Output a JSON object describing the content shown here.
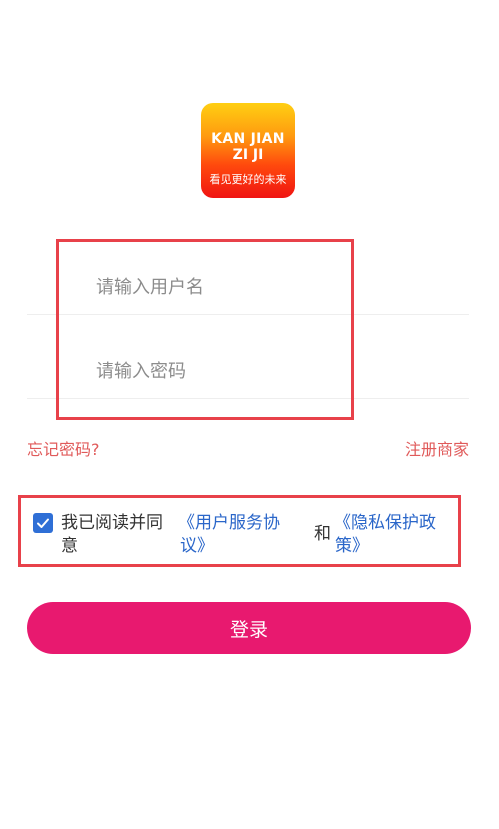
{
  "logo": {
    "line1": "KAN JIAN",
    "line2": "ZI JI",
    "slogan": "看见更好的未来"
  },
  "form": {
    "username_placeholder": "请输入用户名",
    "password_placeholder": "请输入密码"
  },
  "links": {
    "forgot_password": "忘记密码?",
    "register_merchant": "注册商家"
  },
  "agreement": {
    "checked": true,
    "text_line1": "我已阅读并同",
    "text_line2": "意",
    "user_agreement_line1": "《用户服务协",
    "user_agreement_line2": "议》",
    "and": "和",
    "privacy_line1": "《隐私保护政",
    "privacy_line2": "策》"
  },
  "login_button": "登录",
  "colors": {
    "accent": "#e8196f",
    "link_red": "#e05a5a",
    "link_blue": "#2a66c9",
    "checkbox": "#2f6fd6",
    "highlight_box": "#e8414a"
  }
}
